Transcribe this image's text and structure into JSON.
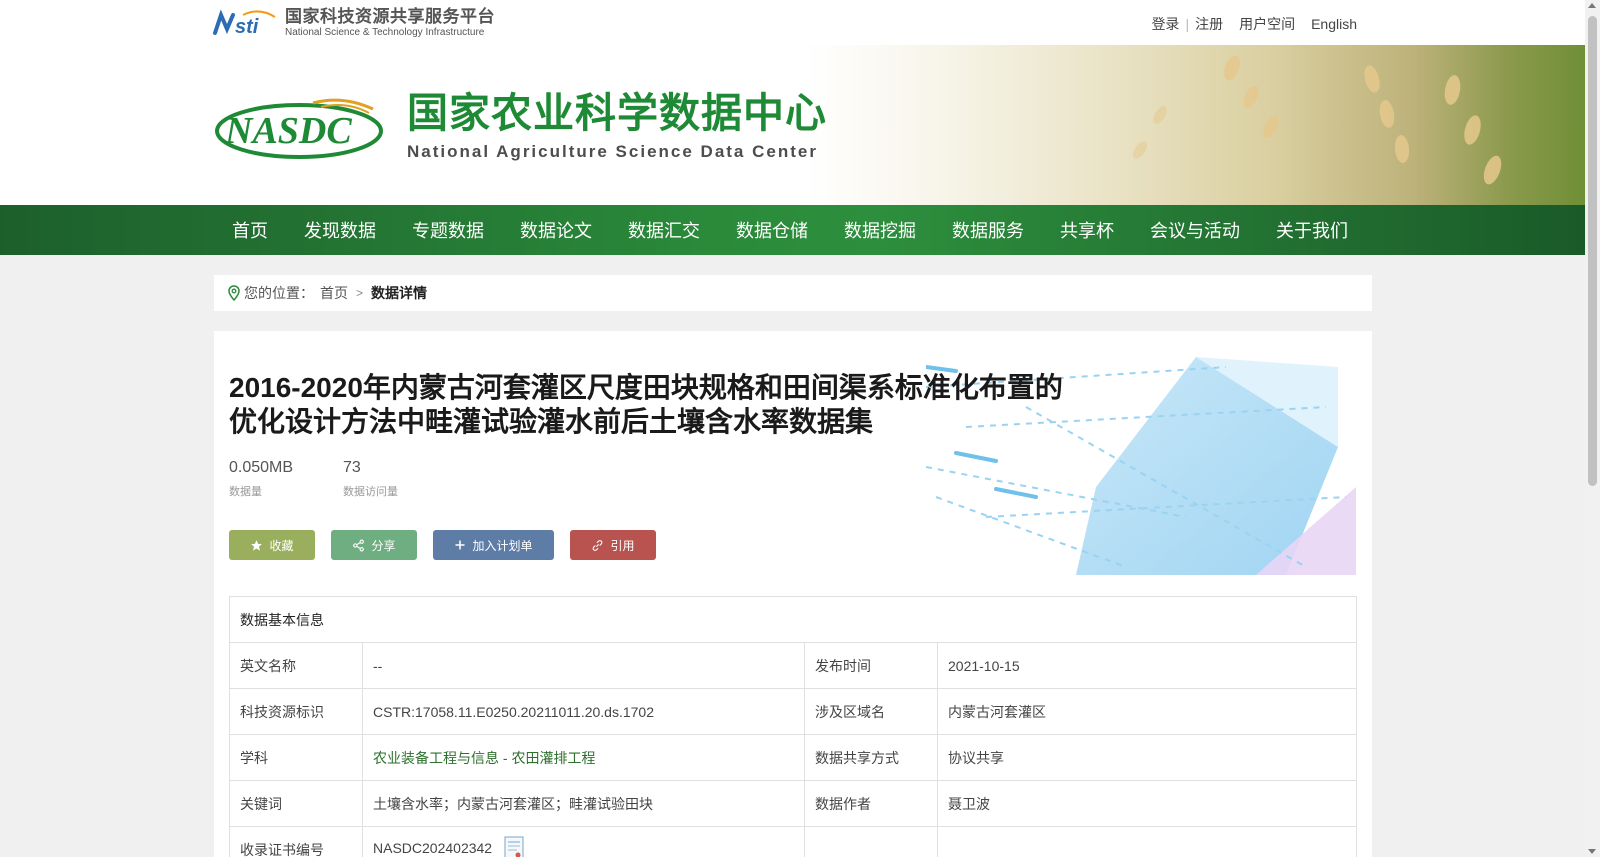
{
  "top": {
    "brand_cn": "国家科技资源共享服务平台",
    "brand_en": "National Science & Technology Infrastructure",
    "links": {
      "login": "登录",
      "register": "注册",
      "user_space": "用户空间",
      "english": "English"
    }
  },
  "header": {
    "title_cn": "国家农业科学数据中心",
    "title_en": "National Agriculture Science Data Center"
  },
  "nav": {
    "items": [
      "首页",
      "发现数据",
      "专题数据",
      "数据论文",
      "数据汇交",
      "数据仓储",
      "数据挖掘",
      "数据服务",
      "共享杯",
      "会议与活动",
      "关于我们"
    ]
  },
  "breadcrumb": {
    "prefix": "您的位置：",
    "home": "首页",
    "current": "数据详情"
  },
  "dataset": {
    "title_line1": "2016-2020年内蒙古河套灌区尺度田块规格和田间渠系标准化布置的",
    "title_line2": "优化设计方法中畦灌试验灌水前后土壤含水率数据集",
    "size_value": "0.050MB",
    "size_label": "数据量",
    "visits_value": "73",
    "visits_label": "数据访问量"
  },
  "actions": {
    "favorite": "收藏",
    "share": "分享",
    "add_plan": "加入计划单",
    "cite": "引用"
  },
  "info": {
    "section_title": "数据基本信息",
    "rows": [
      {
        "k1": "英文名称",
        "v1": "--",
        "k2": "发布时间",
        "v2": "2021-10-15"
      },
      {
        "k1": "科技资源标识",
        "v1": "CSTR:17058.11.E0250.20211011.20.ds.1702",
        "k2": "涉及区域名",
        "v2": "内蒙古河套灌区"
      },
      {
        "k1": "学科",
        "v1": "农业装备工程与信息 - 农田灌排工程",
        "k2": "数据共享方式",
        "v2": "协议共享"
      },
      {
        "k1": "关键词",
        "v1": "土壤含水率；内蒙古河套灌区；畦灌试验田块",
        "k2": "数据作者",
        "v2": "聂卫波"
      },
      {
        "k1": "收录证书编号",
        "v1": "NASDC202402342",
        "k2": "",
        "v2": ""
      }
    ]
  },
  "colors": {
    "brand_green": "#1f8a35",
    "nav_green": "#2a8a3a",
    "fav": "#9aaf5d",
    "share": "#6fae80",
    "plan": "#5e7da6",
    "cite": "#b8534f"
  }
}
